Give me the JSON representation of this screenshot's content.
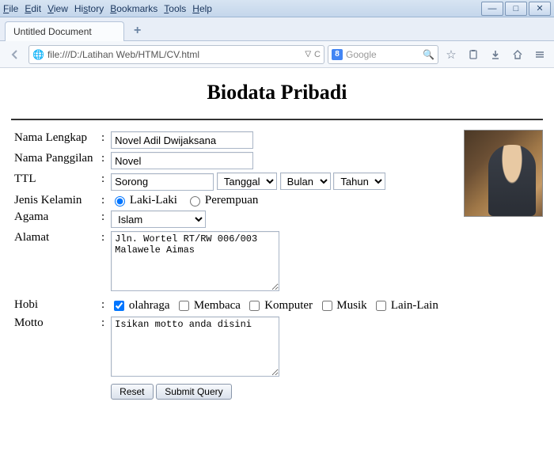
{
  "menu": [
    "File",
    "Edit",
    "View",
    "History",
    "Bookmarks",
    "Tools",
    "Help"
  ],
  "tab_title": "Untitled Document",
  "url": "file:///D:/Latihan Web/HTML/CV.html",
  "reload_hint": "C",
  "search_placeholder": "Google",
  "search_engine_badge": "8",
  "page": {
    "title": "Biodata Pribadi",
    "labels": {
      "nama_lengkap": "Nama Lengkap",
      "nama_panggilan": "Nama Panggilan",
      "ttl": "TTL",
      "jenis_kelamin": "Jenis Kelamin",
      "agama": "Agama",
      "alamat": "Alamat",
      "hobi": "Hobi",
      "motto": "Motto"
    },
    "values": {
      "nama_lengkap": "Novel Adil Dwijaksana",
      "nama_panggilan": "Novel",
      "ttl_kota": "Sorong",
      "ttl_tanggal": "Tanggal",
      "ttl_bulan": "Bulan",
      "ttl_tahun": "Tahun",
      "agama": "Islam",
      "alamat": "Jln. Wortel RT/RW 006/003 Malawele Aimas",
      "motto": "Isikan motto anda disini"
    },
    "gender": {
      "male": "Laki-Laki",
      "female": "Perempuan"
    },
    "hobbies": {
      "olahraga": "olahraga",
      "membaca": "Membaca",
      "komputer": "Komputer",
      "musik": "Musik",
      "lain": "Lain-Lain"
    },
    "buttons": {
      "reset": "Reset",
      "submit": "Submit Query"
    }
  }
}
